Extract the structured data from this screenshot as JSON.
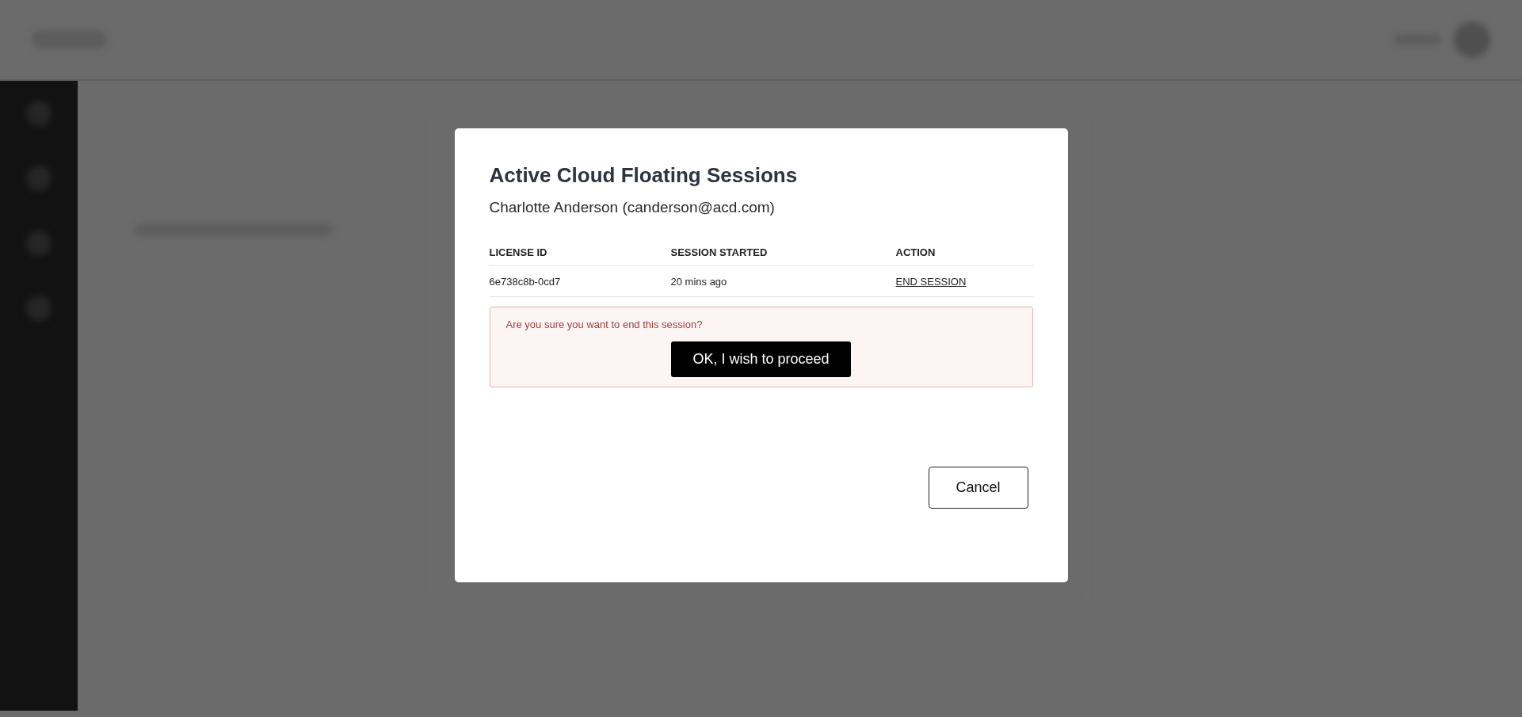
{
  "dialog": {
    "title": "Active Cloud Floating Sessions",
    "user": "Charlotte Anderson (canderson@acd.com)",
    "table": {
      "columns": [
        "LICENSE ID",
        "SESSION STARTED",
        "ACTION"
      ],
      "rows": [
        {
          "license_id": "6e738c8b-0cd7",
          "session_started": "20 mins ago",
          "action": "END SESSION"
        }
      ]
    },
    "confirm": {
      "message": "Are you sure you want to end this session?",
      "button": "OK, I wish to proceed"
    },
    "cancel_button": "Cancel"
  }
}
